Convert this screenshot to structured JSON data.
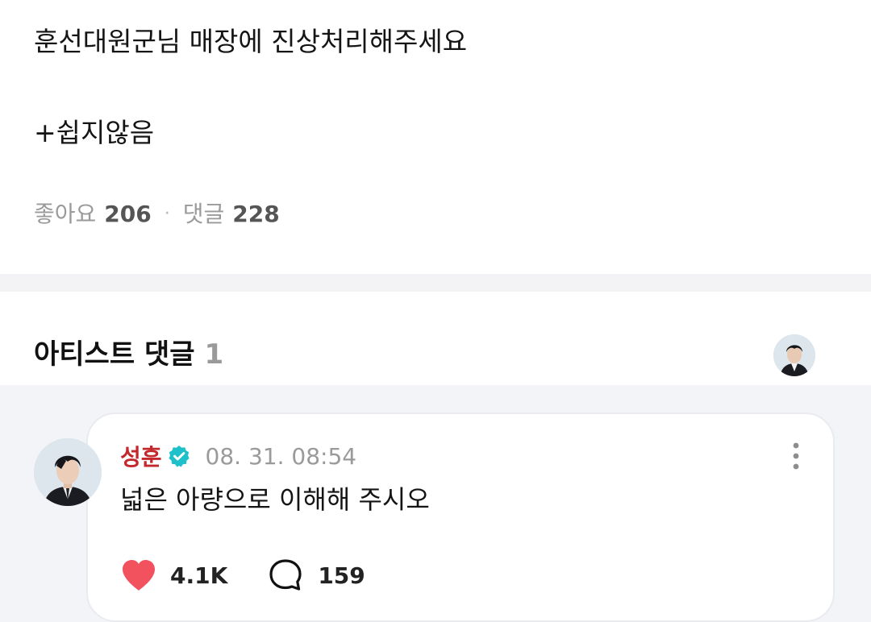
{
  "post": {
    "line1": "훈선대원군님 매장에 진상처리해주세요",
    "line2": "+쉽지않음",
    "likes_label": "좋아요",
    "likes_count": "206",
    "separator": "·",
    "comments_label": "댓글",
    "comments_count": "228"
  },
  "artist_comments": {
    "title": "아티스트 댓글",
    "count": "1"
  },
  "comment": {
    "author": "성훈",
    "timestamp": "08. 31. 08:54",
    "text": "넓은 아량으로 이해해 주시오",
    "like_count": "4.1K",
    "reply_count": "159"
  },
  "colors": {
    "author_name": "#c2282c",
    "verified_badge": "#1ec1c9",
    "heart": "#f2515e",
    "background_band": "#f3f4f7"
  },
  "icons": {
    "verified": "verified-badge-icon",
    "more": "more-vertical-icon",
    "like": "heart-icon",
    "reply": "speech-bubble-icon"
  }
}
